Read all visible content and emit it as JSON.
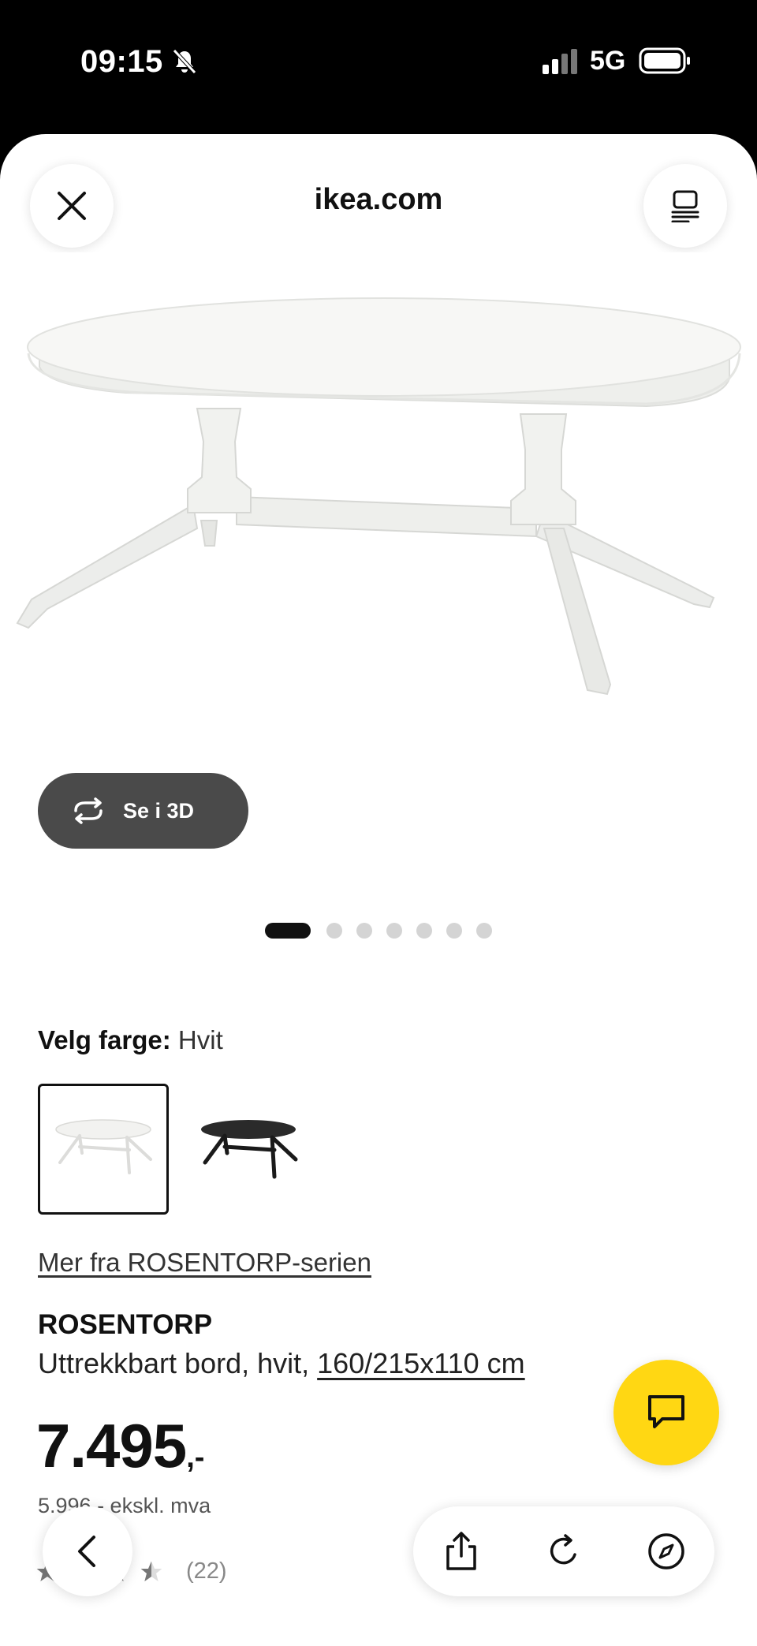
{
  "status_bar": {
    "time": "09:15",
    "network": "5G",
    "icons": [
      "bell-muted-icon",
      "signal-icon",
      "battery-icon"
    ]
  },
  "browser": {
    "title": "ikea.com",
    "close_icon": "close-icon",
    "reader_icon": "reader-mode-icon"
  },
  "gallery": {
    "view_3d_label": "Se i 3D",
    "image_count": 7,
    "active_index": 0
  },
  "color_selector": {
    "label": "Velg farge:",
    "value": "Hvit",
    "options": [
      "Hvit",
      "Svart"
    ],
    "selected": "Hvit"
  },
  "product": {
    "series_link": "Mer fra ROSENTORP-serien",
    "name": "ROSENTORP",
    "description": "Uttrekkbart bord, hvit,",
    "dimensions": "160/215x110 cm",
    "price": "7.495",
    "price_suffix": ",-",
    "price_ex_vat": "5.996,- ekskl. mva",
    "rating": 3.5,
    "review_count": "(22)"
  },
  "colors": {
    "chat_button": "#ffd713",
    "view_3d_button": "#4a4a4a",
    "text": "#111111"
  },
  "toolbar": {
    "icons": [
      "back-icon",
      "share-icon",
      "reload-icon",
      "compass-icon"
    ]
  }
}
